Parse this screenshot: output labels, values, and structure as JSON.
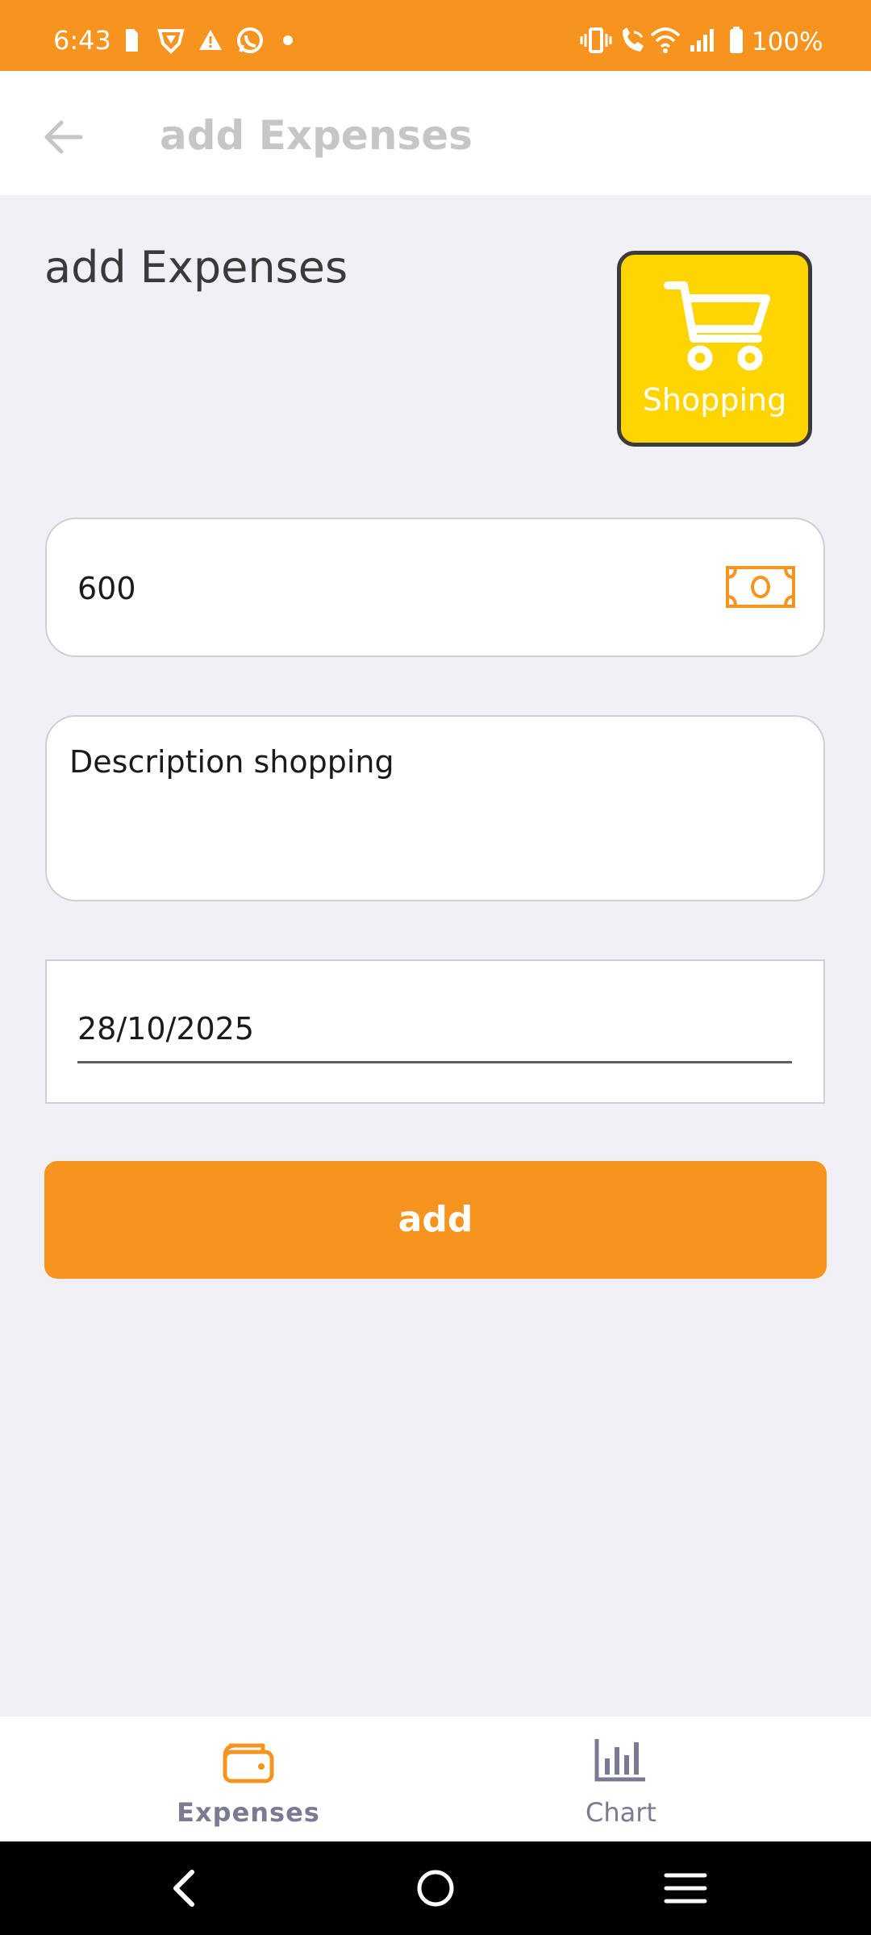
{
  "status_bar": {
    "time": "6:43",
    "battery": "100%",
    "icons": [
      "sim-card-icon",
      "brave-icon",
      "alert-icon",
      "whatsapp-icon",
      "dot-icon",
      "vibrate-icon",
      "wifi-call-icon",
      "wifi-icon",
      "signal-icon",
      "battery-icon"
    ]
  },
  "app_bar": {
    "title": "add Expenses",
    "back_icon": "arrow-left-icon"
  },
  "form": {
    "heading": "add Expenses",
    "category": {
      "label": "Shopping",
      "icon": "shopping-cart-icon",
      "color": "#ffd500"
    },
    "amount": {
      "value": "600",
      "icon": "cash-icon"
    },
    "description": {
      "value": "Description shopping"
    },
    "date": {
      "value": "28/10/2025"
    },
    "submit_label": "add"
  },
  "bottom_nav": {
    "items": [
      {
        "label": "Expenses",
        "icon": "wallet-icon",
        "active": true
      },
      {
        "label": "Chart",
        "icon": "bar-chart-icon",
        "active": false
      }
    ]
  },
  "colors": {
    "accent": "#f7941f",
    "category": "#ffd500",
    "background": "#f1f1f5"
  }
}
